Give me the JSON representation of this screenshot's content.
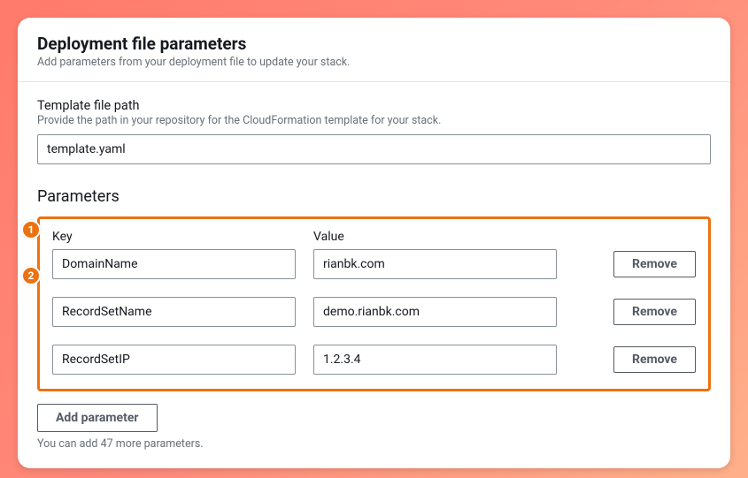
{
  "header": {
    "title": "Deployment file parameters",
    "subtitle": "Add parameters from your deployment file to update your stack."
  },
  "templatePath": {
    "label": "Template file path",
    "hint": "Provide the path in your repository for the CloudFormation template for your stack.",
    "value": "template.yaml"
  },
  "parametersSection": {
    "heading": "Parameters",
    "keyLabel": "Key",
    "valueLabel": "Value",
    "removeLabel": "Remove",
    "rows": [
      {
        "key": "DomainName",
        "value": "rianbk.com"
      },
      {
        "key": "RecordSetName",
        "value": "demo.rianbk.com"
      },
      {
        "key": "RecordSetIP",
        "value": "1.2.3.4"
      }
    ],
    "addLabel": "Add parameter",
    "footer": "You can add 47 more parameters."
  },
  "annotations": {
    "badge1": "1",
    "badge2": "2"
  }
}
